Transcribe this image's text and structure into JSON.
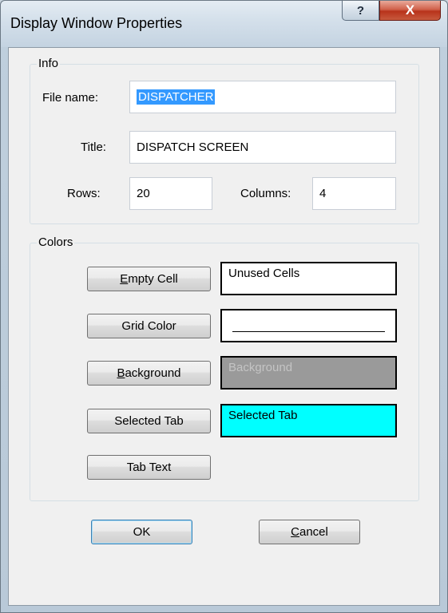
{
  "window": {
    "title": "Display Window Properties",
    "help_glyph": "?",
    "close_glyph": "X"
  },
  "info": {
    "group_label": "Info",
    "file_name_label": "File name:",
    "file_name_value": "DISPATCHER",
    "title_label": "Title:",
    "title_value": "DISPATCH SCREEN",
    "rows_label": "Rows:",
    "rows_value": "20",
    "columns_label": "Columns:",
    "columns_value": "4"
  },
  "colors": {
    "group_label": "Colors",
    "empty_cell": {
      "button_pre": "",
      "button_mnemonic": "E",
      "button_post": "mpty Cell",
      "swatch_text": "Unused Cells",
      "swatch_bg": "#ffffff",
      "swatch_fg": "#000000"
    },
    "grid_color": {
      "button_label": "Grid Color",
      "swatch_line_color": "#000000",
      "swatch_bg": "#ffffff"
    },
    "background": {
      "button_pre": "",
      "button_mnemonic": "B",
      "button_post": "ackground",
      "swatch_text": "Background",
      "swatch_bg": "#9a9a9a",
      "swatch_fg": "#c4c4c4"
    },
    "selected_tab": {
      "button_label": "Selected Tab",
      "swatch_text": "Selected Tab",
      "swatch_bg": "#00ffff",
      "swatch_fg": "#000000"
    },
    "tab_text": {
      "button_label": "Tab Text"
    }
  },
  "footer": {
    "ok_label": "OK",
    "cancel_mnemonic": "C",
    "cancel_post": "ancel"
  }
}
